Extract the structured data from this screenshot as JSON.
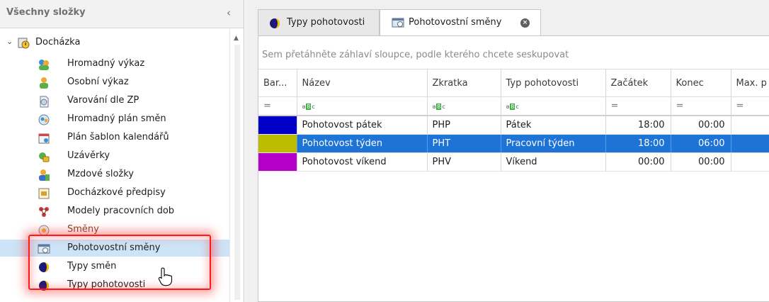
{
  "left": {
    "title": "Všechny složky",
    "collapse_glyph": "‹",
    "root": {
      "label": "Docházka"
    },
    "items": [
      {
        "label": "Hromadný výkaz",
        "icon": "people-report-icon"
      },
      {
        "label": "Osobní výkaz",
        "icon": "person-icon"
      },
      {
        "label": "Varování dle ZP",
        "icon": "warning-document-icon"
      },
      {
        "label": "Hromadný plán směn",
        "icon": "group-calendar-icon"
      },
      {
        "label": "Plán šablon kalendářů",
        "icon": "calendar-template-icon"
      },
      {
        "label": "Uzávěrky",
        "icon": "lock-icon"
      },
      {
        "label": "Mzdové složky",
        "icon": "payroll-icon"
      },
      {
        "label": "Docházkové předpisy",
        "icon": "rules-icon"
      },
      {
        "label": "Modely pracovních dob",
        "icon": "workhours-model-icon"
      },
      {
        "label": "Směny",
        "icon": "shift-icon"
      },
      {
        "label": "Pohotovostní směny",
        "icon": "standby-shift-icon"
      },
      {
        "label": "Typy směn",
        "icon": "shift-type-icon"
      },
      {
        "label": "Typy pohotovosti",
        "icon": "standby-type-icon"
      }
    ]
  },
  "tabs": [
    {
      "label": "Typy pohotovosti",
      "icon": "standby-type-icon"
    },
    {
      "label": "Pohotovostní směny",
      "icon": "standby-shift-icon",
      "close": "×"
    }
  ],
  "grid": {
    "group_hint": "Sem přetáhněte záhlaví sloupce, podle kterého chcete seskupovat",
    "columns": [
      "Bar...",
      "Název",
      "Zkratka",
      "Typ pohotovosti",
      "Začátek",
      "Konec",
      "Max. p"
    ],
    "filter_eq": "=",
    "filter_abc": {
      "a": "a",
      "b": "B",
      "c": "c"
    },
    "rows": [
      {
        "color": "#0000c8",
        "name": "Pohotovost pátek",
        "abbr": "PHP",
        "type": "Pátek",
        "start": "18:00",
        "end": "00:00"
      },
      {
        "color": "#bcbc00",
        "name": "Pohotovost týden",
        "abbr": "PHT",
        "type": "Pracovní týden",
        "start": "18:00",
        "end": "06:00"
      },
      {
        "color": "#b400c8",
        "name": "Pohotovost víkend",
        "abbr": "PHV",
        "type": "Víkend",
        "start": "00:00",
        "end": "00:00"
      }
    ]
  },
  "colors": {
    "selection": "#1e73d6",
    "highlight": "#ff1a1a",
    "tree_selected": "#cde3f7"
  }
}
